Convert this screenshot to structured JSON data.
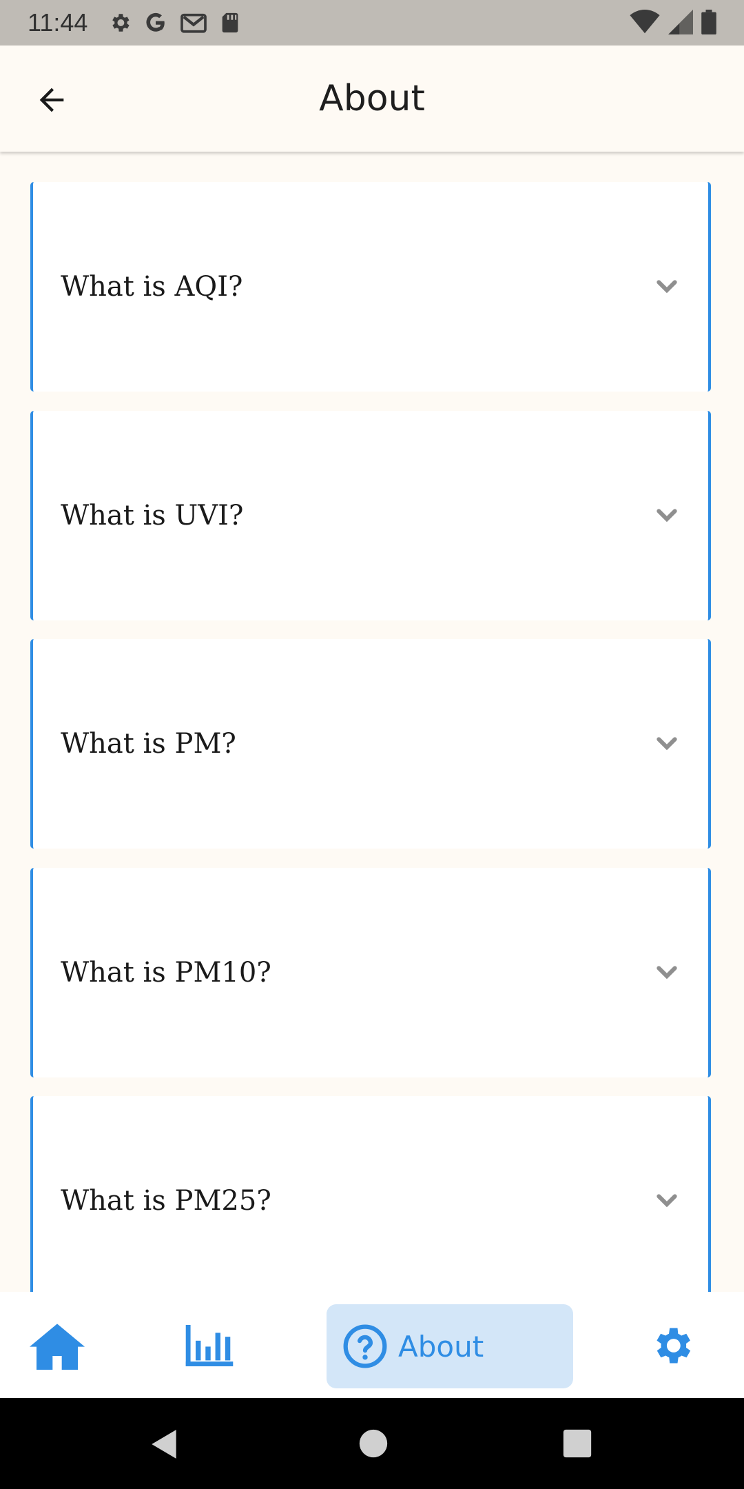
{
  "status_bar": {
    "time": "11:44",
    "left_icons": [
      "settings-icon",
      "google-icon",
      "gmail-icon",
      "sd-card-icon"
    ],
    "right_icons": [
      "wifi-icon",
      "signal-icon",
      "battery-icon"
    ]
  },
  "app_bar": {
    "title": "About",
    "back_icon": "arrow-back-icon"
  },
  "faq": [
    {
      "question": "What is AQI?"
    },
    {
      "question": "What is UVI?"
    },
    {
      "question": "What is PM?"
    },
    {
      "question": "What is PM10?"
    },
    {
      "question": "What is PM25?"
    }
  ],
  "bottom_nav": {
    "items": [
      {
        "icon": "home-icon"
      },
      {
        "icon": "bar-chart-icon"
      },
      {
        "icon": "help-circle-icon",
        "label": "About",
        "active": true
      },
      {
        "icon": "settings-icon"
      }
    ]
  },
  "colors": {
    "accent": "#2f8de4",
    "active_nav_bg": "#d3e6f8",
    "background": "#fefaf4"
  }
}
